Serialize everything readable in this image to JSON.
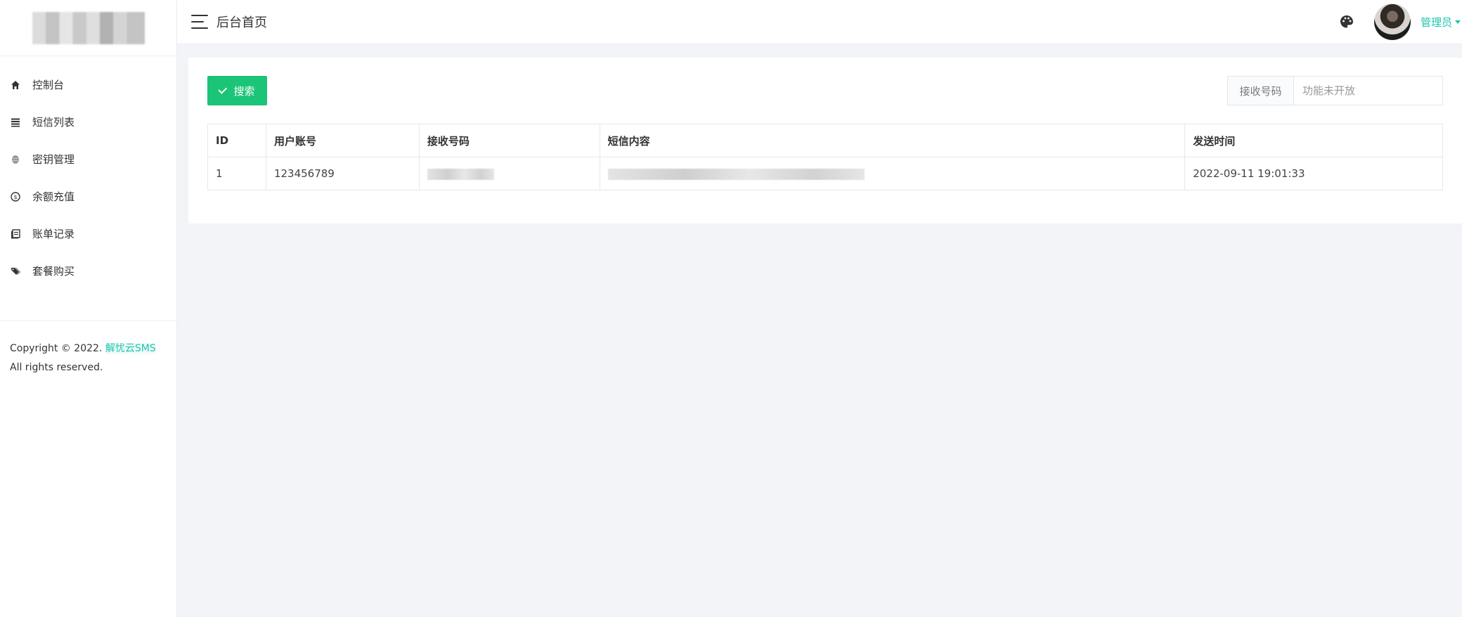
{
  "sidebar": {
    "logo_alt": "logo",
    "items": [
      {
        "label": "控制台",
        "icon": "home-icon"
      },
      {
        "label": "短信列表",
        "icon": "list-icon"
      },
      {
        "label": "密钥管理",
        "icon": "key-icon"
      },
      {
        "label": "余额充值",
        "icon": "coin-icon"
      },
      {
        "label": "账单记录",
        "icon": "book-icon"
      },
      {
        "label": "套餐购买",
        "icon": "tags-icon"
      }
    ],
    "copyright": {
      "prefix": "Copyright © 2022.",
      "brand": "解忧云SMS",
      "suffix": "All rights reserved."
    }
  },
  "header": {
    "title": "后台首页",
    "user": {
      "name": "管理员"
    }
  },
  "toolbar": {
    "search_label": "搜索",
    "filter_label": "接收号码",
    "filter_placeholder": "功能未开放"
  },
  "table": {
    "columns": [
      "ID",
      "用户账号",
      "接收号码",
      "短信内容",
      "发送时间"
    ],
    "rows": [
      {
        "id": "1",
        "user": "123456789",
        "phone": "",
        "content": "",
        "time": "2022-09-11 19:01:33"
      }
    ]
  },
  "colors": {
    "accent": "#1bc5ae",
    "button": "#1bc477",
    "background": "#f3f4f8"
  }
}
